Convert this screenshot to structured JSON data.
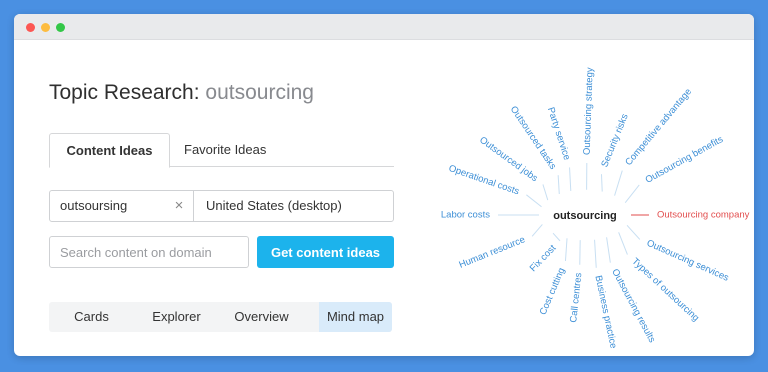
{
  "window": {
    "controls": [
      "close",
      "minimize",
      "maximize"
    ]
  },
  "page": {
    "title_prefix": "Topic Research: ",
    "title_keyword": "outsourcing"
  },
  "tabs": [
    {
      "label": "Content Ideas",
      "active": true
    },
    {
      "label": "Favorite Ideas",
      "active": false
    }
  ],
  "form": {
    "keyword_value": "outsoursing",
    "clear_icon": "×",
    "database": "United States (desktop)",
    "domain_placeholder": "Search content on domain",
    "submit_label": "Get content ideas"
  },
  "views": [
    {
      "label": "Cards",
      "active": false
    },
    {
      "label": "Explorer",
      "active": false
    },
    {
      "label": "Overview",
      "active": false
    },
    {
      "label": "Mind map",
      "active": true
    }
  ],
  "mind_map": {
    "center": "outsourcing",
    "colors": {
      "topic": "#3d8fd6",
      "highlight": "#e24e4e",
      "spoke": "#c8dff2"
    },
    "topics": [
      {
        "label": "Labor costs",
        "highlight": false
      },
      {
        "label": "Operational costs",
        "highlight": false
      },
      {
        "label": "Outsourced jobs",
        "highlight": false
      },
      {
        "label": "Outsourced tasks",
        "highlight": false
      },
      {
        "label": "Party service",
        "highlight": false
      },
      {
        "label": "Outsourcing strategy",
        "highlight": false
      },
      {
        "label": "Security risks",
        "highlight": false
      },
      {
        "label": "Competitive advantage",
        "highlight": false
      },
      {
        "label": "Outsourcing benefits",
        "highlight": false
      },
      {
        "label": "Outsourcing company",
        "highlight": true
      },
      {
        "label": "Outsourcing services",
        "highlight": false
      },
      {
        "label": "Types of outsourcing",
        "highlight": false
      },
      {
        "label": "Outsourcing results",
        "highlight": false
      },
      {
        "label": "Business practice",
        "highlight": false
      },
      {
        "label": "Call centres",
        "highlight": false
      },
      {
        "label": "Cost cutting",
        "highlight": false
      },
      {
        "label": "Fix cost",
        "highlight": false
      },
      {
        "label": "Human resource",
        "highlight": false
      }
    ]
  }
}
